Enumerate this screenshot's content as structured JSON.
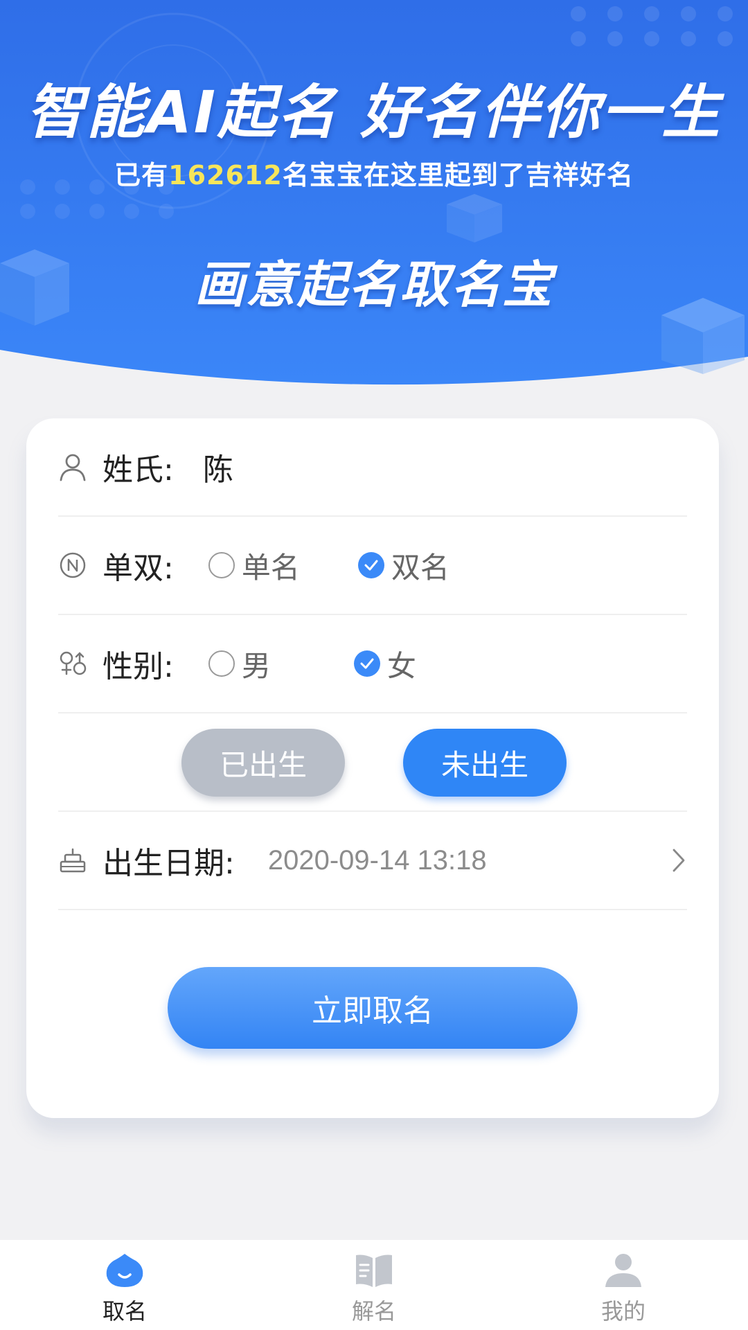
{
  "banner": {
    "slogan": "智能AI起名 好名伴你一生",
    "count_prefix": "已有",
    "count": "162612",
    "count_suffix": "名宝宝在这里起到了吉祥好名",
    "app_name": "画意起名取名宝",
    "colors": {
      "top": "#2f6ee8",
      "bottom": "#3b86f8",
      "count_highlight": "#f7e55a"
    }
  },
  "form": {
    "surname": {
      "label": "姓氏:",
      "value": "陈",
      "icon": "user-icon"
    },
    "name_length": {
      "label": "单双:",
      "icon": "n-circle-icon",
      "options": [
        {
          "label": "单名",
          "checked": false
        },
        {
          "label": "双名",
          "checked": true
        }
      ]
    },
    "gender": {
      "label": "性别:",
      "icon": "gender-icon",
      "options": [
        {
          "label": "男",
          "checked": false
        },
        {
          "label": "女",
          "checked": true
        }
      ]
    },
    "birth_status": {
      "born_label": "已出生",
      "unborn_label": "未出生",
      "selected": "未出生"
    },
    "birth_date": {
      "label": "出生日期:",
      "value": "2020-09-14 13:18",
      "icon": "cake-icon"
    },
    "submit_label": "立即取名",
    "accent_color": "#2f86f6"
  },
  "tabbar": {
    "tabs": [
      {
        "label": "取名",
        "icon": "mascot-icon",
        "active": true
      },
      {
        "label": "解名",
        "icon": "book-icon",
        "active": false
      },
      {
        "label": "我的",
        "icon": "profile-icon",
        "active": false
      }
    ]
  }
}
